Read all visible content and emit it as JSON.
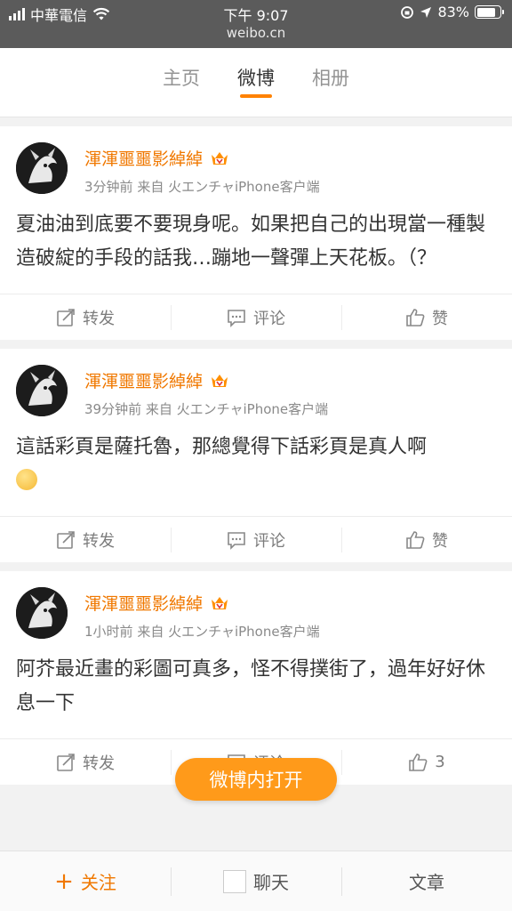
{
  "status_bar": {
    "carrier": "中華電信",
    "time": "下午 9:07",
    "url": "weibo.cn",
    "battery": "83%",
    "battery_level": 0.83
  },
  "tabs": [
    {
      "label": "主页",
      "active": false
    },
    {
      "label": "微博",
      "active": true
    },
    {
      "label": "相册",
      "active": false
    }
  ],
  "posts": [
    {
      "user": "渾渾噩噩影綽綽",
      "time": "3分钟前",
      "source": "来自 火エンチャiPhone客户端",
      "text": "夏油油到底要不要現身呢。如果把自己的出現當一種製造破綻的手段的話我…蹦地一聲彈上天花板。（？",
      "actions": {
        "repost": "转发",
        "comment": "评论",
        "like": "赞"
      }
    },
    {
      "user": "渾渾噩噩影綽綽",
      "time": "39分钟前",
      "source": "来自 火エンチャiPhone客户端",
      "text": "這話彩頁是薩托魯，那總覺得下話彩頁是真人啊",
      "has_emoji": true,
      "actions": {
        "repost": "转发",
        "comment": "评论",
        "like": "赞"
      }
    },
    {
      "user": "渾渾噩噩影綽綽",
      "time": "1小时前",
      "source": "来自 火エンチャiPhone客户端",
      "text": "阿芥最近畫的彩圖可真多，怪不得撲街了，過年好好休息一下",
      "actions": {
        "repost": "转发",
        "comment": "评论",
        "like": "3"
      }
    }
  ],
  "open_app_button": "微博内打开",
  "bottom_bar": {
    "follow": "关注",
    "chat": "聊天",
    "article": "文章"
  },
  "colors": {
    "accent": "#ff8200",
    "username": "#f07800",
    "open_button": "#ff9a1a"
  }
}
